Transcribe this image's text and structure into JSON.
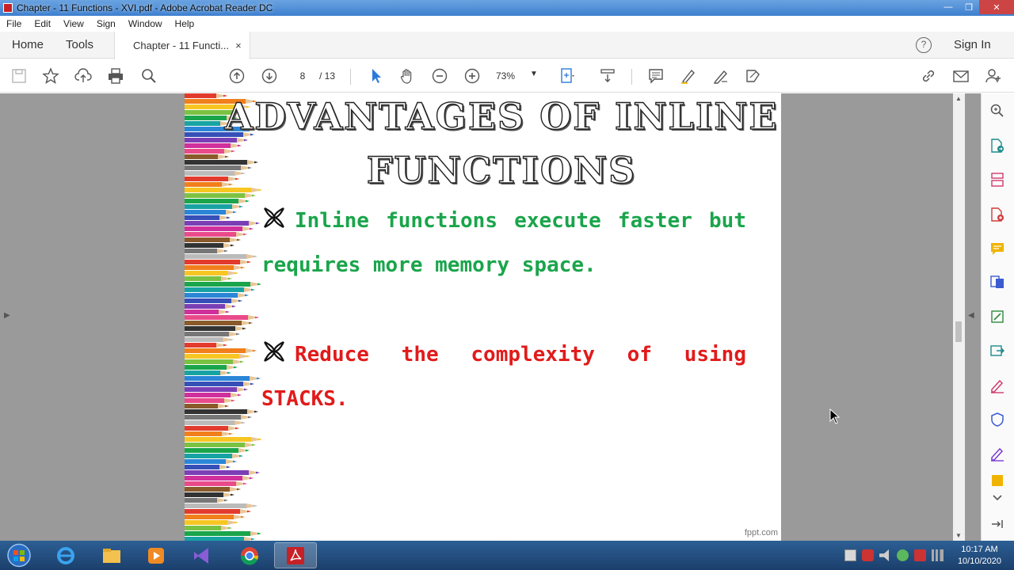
{
  "window": {
    "title": "Chapter - 11 Functions - XVI.pdf - Adobe Acrobat Reader DC",
    "controls": [
      "—",
      "❐",
      "✕"
    ]
  },
  "menu": [
    "File",
    "Edit",
    "View",
    "Sign",
    "Window",
    "Help"
  ],
  "tabs": {
    "home": "Home",
    "tools": "Tools",
    "document": "Chapter - 11 Functi...",
    "close_glyph": "×"
  },
  "header": {
    "help_glyph": "?",
    "sign_in": "Sign In"
  },
  "toolbar": {
    "current_page": "8",
    "total_pages": "/ 13",
    "zoom": "73%",
    "zoom_caret": "▼"
  },
  "slide": {
    "title_line1": "ADVANTAGES OF INLINE",
    "title_line2": "FUNCTIONS",
    "bullet1": "Inline functions execute faster but requires more memory space.",
    "bullet2": "Reduce the complexity of using STACKS.",
    "watermark": "fppt.com",
    "colors": {
      "bullet1": "#1aa54b",
      "bullet2": "#e11b1b"
    }
  },
  "right_tools": [
    "search-icon",
    "export-pdf-icon",
    "organize-pages-icon",
    "create-pdf-icon",
    "comment-icon",
    "combine-files-icon",
    "edit-pdf-icon",
    "send-icon",
    "fill-sign-icon",
    "protect-icon",
    "more-tools-icon",
    "stamp-icon",
    "chevron-down-icon",
    "collapse-pane-icon"
  ],
  "taskbar": {
    "time": "10:17 AM",
    "date": "10/10/2020"
  }
}
